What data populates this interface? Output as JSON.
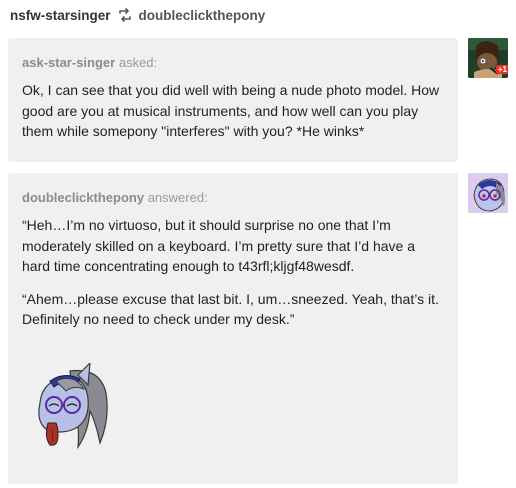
{
  "header": {
    "username": "nsfw-starsinger",
    "source": "doubleclickthepony"
  },
  "question": {
    "asker": "ask-star-singer",
    "verb": "asked:",
    "text": "Ok, I can see that you did well with being a nude photo model. How good are you at musical instruments, and how well can you play them while somepony \"interferes\" with you? *He winks*",
    "avatar_badge": "+1"
  },
  "answer": {
    "answerer": "doubleclickthepony",
    "verb": "answered:",
    "para1": "“Heh…I’m no virtuoso, but it should surprise no one that I’m moderately skilled on a keyboard.  I’m pretty sure that I’d have a hard time concentrating enough to t43rfl;kljgf48wesdf.",
    "para2": "“Ahem…please excuse that last bit.  I, um…sneezed.  Yeah, that’s it.  Definitely no need to check under my desk.”"
  },
  "icons": {
    "reblog": "reblog-icon",
    "asker_avatar": "asker-avatar",
    "answerer_avatar": "answerer-avatar",
    "pony": "pony-tongue-illustration"
  }
}
